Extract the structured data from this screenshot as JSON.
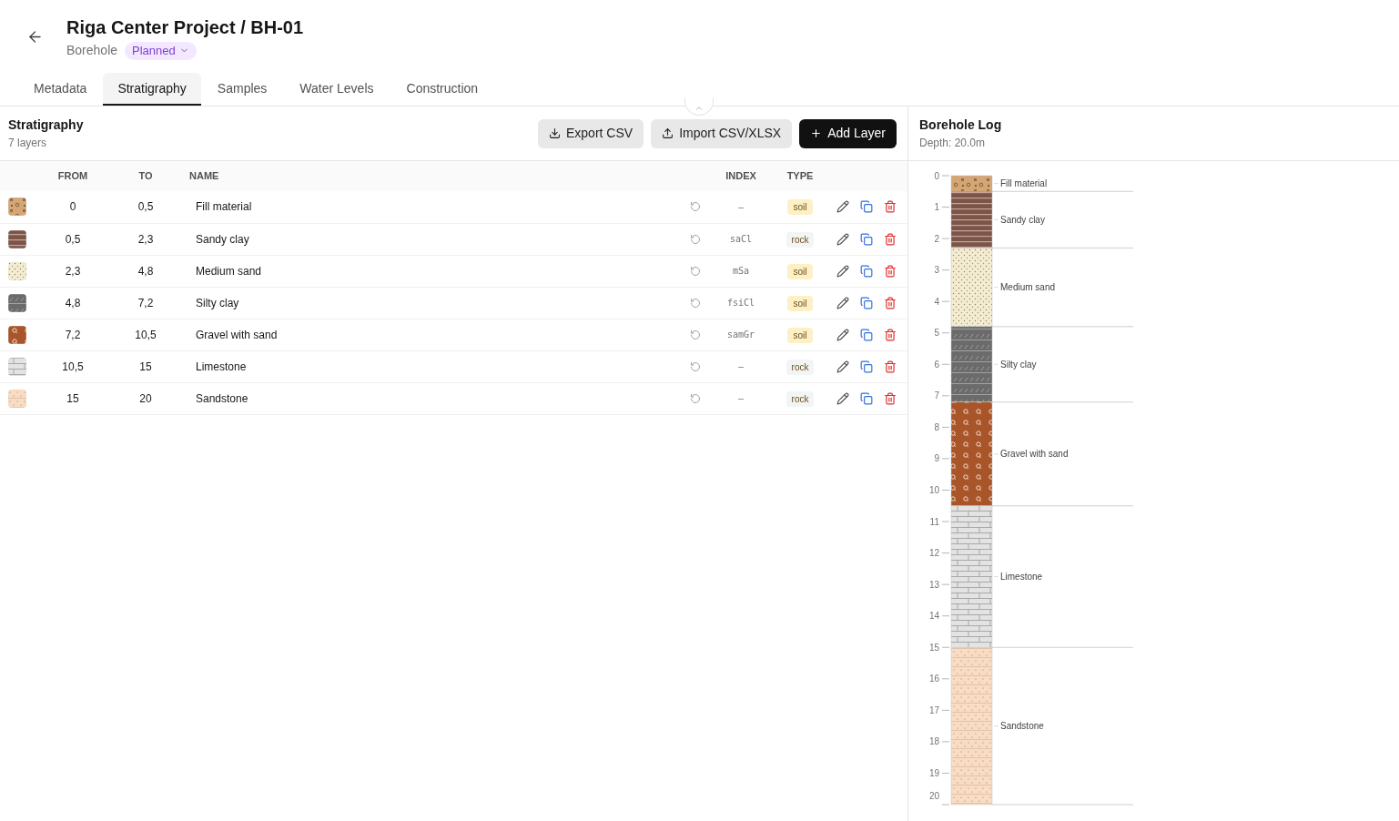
{
  "header": {
    "title": "Riga Center Project / BH-01",
    "subtitle": "Borehole",
    "status": "Planned"
  },
  "tabs": [
    {
      "label": "Metadata",
      "selected": false
    },
    {
      "label": "Stratigraphy",
      "selected": true
    },
    {
      "label": "Samples",
      "selected": false
    },
    {
      "label": "Water Levels",
      "selected": false
    },
    {
      "label": "Construction",
      "selected": false
    }
  ],
  "stratigraphy": {
    "title": "Stratigraphy",
    "count": "7 layers",
    "buttons": [
      {
        "label": "Export CSV",
        "kind": "export"
      },
      {
        "label": "Import CSV/XLSX",
        "kind": "import"
      },
      {
        "label": "Add Layer",
        "kind": "add"
      }
    ],
    "columns": [
      "FROM",
      "TO",
      "NAME",
      "INDEX",
      "TYPE"
    ],
    "rows": [
      {
        "kind": "fill",
        "from": "0",
        "to": "0,5",
        "name": "Fill material",
        "index": "–",
        "type": "soil",
        "color": "#fdf0c4"
      },
      {
        "kind": "sandy-clay",
        "from": "0,5",
        "to": "2,3",
        "name": "Sandy clay",
        "index": "saCl",
        "type": "rock",
        "color": "#f3f4f6"
      },
      {
        "kind": "sand",
        "from": "2,3",
        "to": "4,8",
        "name": "Medium sand",
        "index": "mSa",
        "type": "soil",
        "color": "#fdf0c4"
      },
      {
        "kind": "silty-clay",
        "from": "4,8",
        "to": "7,2",
        "name": "Silty clay",
        "index": "fsiCl",
        "type": "soil",
        "color": "#fdf0c4"
      },
      {
        "kind": "gravel",
        "from": "7,2",
        "to": "10,5",
        "name": "Gravel with sand",
        "index": "samGr",
        "type": "soil",
        "color": "#fdf0c4"
      },
      {
        "kind": "limestone",
        "from": "10,5",
        "to": "15",
        "name": "Limestone",
        "index": "–",
        "type": "rock",
        "color": "#f3f4f6"
      },
      {
        "kind": "sandstone",
        "from": "15",
        "to": "20",
        "name": "Sandstone",
        "index": "–",
        "type": "rock",
        "color": "#f3f4f6"
      }
    ]
  },
  "log": {
    "title": "Borehole Log",
    "depth": "Depth: 20.0m",
    "ticks": [
      "0",
      "1",
      "2",
      "3",
      "4",
      "5",
      "6",
      "7",
      "8",
      "9",
      "10",
      "11",
      "12",
      "13",
      "14",
      "15",
      "16",
      "17",
      "18",
      "19",
      "20"
    ],
    "layers": [
      {
        "label": "Fill material",
        "kind": "fill"
      },
      {
        "label": "Sandy clay",
        "kind": "sandy-clay"
      },
      {
        "label": "Medium sand",
        "kind": "sand"
      },
      {
        "label": "Silty clay",
        "kind": "silty-clay"
      },
      {
        "label": "Gravel with sand",
        "kind": "gravel"
      },
      {
        "label": "Limestone",
        "kind": "limestone"
      },
      {
        "label": "Sandstone",
        "kind": "sandstone"
      }
    ]
  }
}
